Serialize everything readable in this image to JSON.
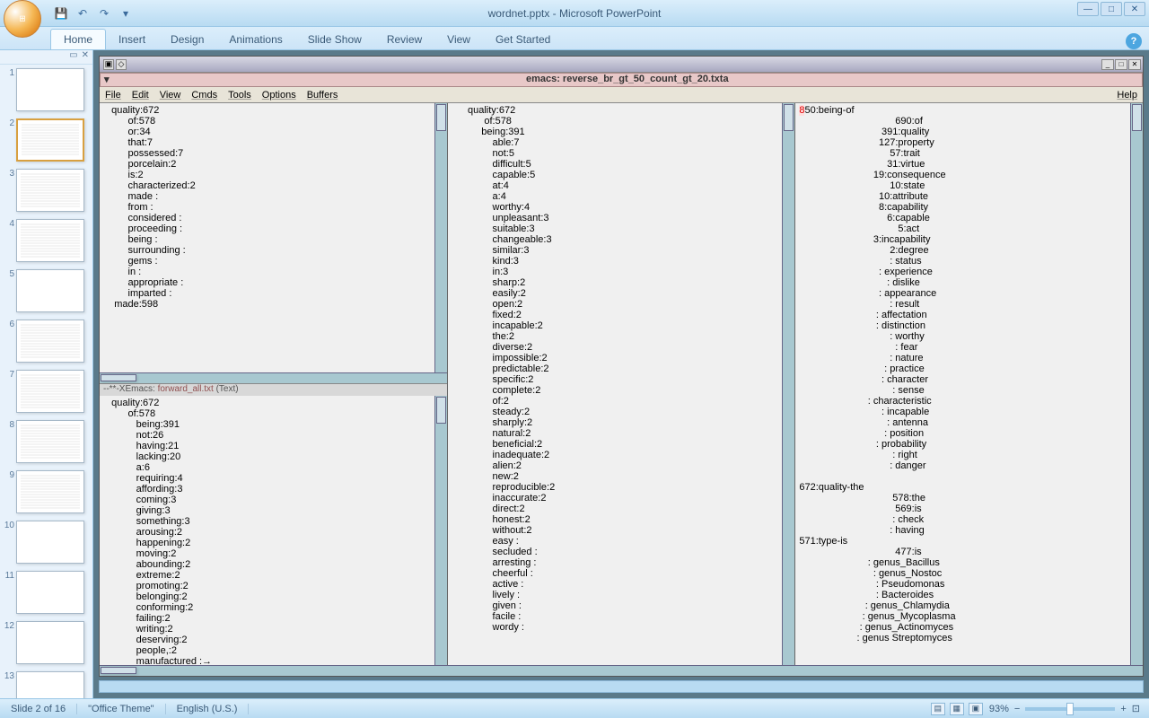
{
  "app": {
    "title": "wordnet.pptx - Microsoft PowerPoint"
  },
  "ribbon": {
    "tabs": [
      "Home",
      "Insert",
      "Design",
      "Animations",
      "Slide Show",
      "Review",
      "View",
      "Get Started"
    ],
    "active": 0
  },
  "slides": {
    "count": 13,
    "active": 2,
    "plain": [
      1,
      5,
      10,
      11,
      12,
      13
    ]
  },
  "emacs": {
    "path_title": "emacs: reverse_br_gt_50_count_gt_20.txta",
    "menus": [
      "File",
      "Edit",
      "View",
      "Cmds",
      "Tools",
      "Options",
      "Buffers"
    ],
    "help": "Help",
    "buffers": {
      "left_top": "   quality:672\n         of:578\n         or:34\n         that:7\n         possessed:7\n         porcelain:2\n         is:2\n         characterized:2\n         made :\n         from :\n         considered :\n         proceeding :\n         being :\n         surrounding :\n         gems :\n         in :\n         appropriate :\n         imparted :\n    made:598",
      "left_mode": "--**-XEmacs: ",
      "left_mode_file": "forward_all.txt",
      "left_mode_tail": "      (Text)",
      "left_bot": "   quality:672\n         of:578\n            being:391\n            not:26\n            having:21\n            lacking:20\n            a:6\n            requiring:4\n            affording:3\n            coming:3\n            giving:3\n            something:3\n            arousing:2\n            happening:2\n            moving:2\n            abounding:2\n            extreme:2\n            promoting:2\n            belonging:2\n            conforming:2\n            failing:2\n            writing:2\n            deserving:2\n            people,:2\n            manufactured :→\n            excessive :\n            seeming :\n            expressing :",
      "mid": "      quality:672\n            of:578\n           being:391\n               able:7\n               not:5\n               difficult:5\n               capable:5\n               at:4\n               a:4\n               worthy:4\n               unpleasant:3\n               suitable:3\n               changeable:3\n               similar:3\n               kind:3\n               in:3\n               sharp:2\n               easily:2\n               open:2\n               fixed:2\n               incapable:2\n               the:2\n               diverse:2\n               impossible:2\n               predictable:2\n               specific:2\n               complete:2\n               of:2\n               steady:2\n               sharply:2\n               natural:2\n               beneficial:2\n               inadequate:2\n               alien:2\n               new:2\n               reproducible:2\n               inaccurate:2\n               direct:2\n               honest:2\n               without:2\n               easy :\n               secluded :\n               arresting :\n               cheerful :\n               active :\n               lively :\n               given :\n               facile :\n               wordy :",
      "right_prefix": "8",
      "right": "50:being-of\n                                   690:of\n                              391:quality\n                             127:property\n                                 57:trait\n                                31:virtue\n                           19:consequence\n                                 10:state\n                             10:attribute\n                             8:capability\n                                6:capable\n                                    5:act\n                           3:incapability\n                                 2:degree\n                                 : status\n                             : experience\n                                : dislike\n                             : appearance\n                                 : result\n                            : affectation\n                            : distinction\n                                 : worthy\n                                   : fear\n                                 : nature\n                               : practice\n                              : character\n                                  : sense\n                         : characteristic\n                              : incapable\n                                : antenna\n                               : position\n                            : probability\n                                  : right\n                                 : danger\n\n672:quality-the\n                                  578:the\n                                   569:is\n                                  : check\n                                 : having\n571:type-is\n                                   477:is\n                         : genus_Bacillus\n                           : genus_Nostoc\n                            : Pseudomonas\n                            : Bacteroides\n                        : genus_Chlamydia\n                       : genus_Mycoplasma\n                      : genus_Actinomyces\n                     : genus Streptomyces"
    }
  },
  "status": {
    "slide": "Slide 2 of 16",
    "theme": "\"Office Theme\"",
    "lang": "English (U.S.)",
    "zoom": "93%"
  }
}
